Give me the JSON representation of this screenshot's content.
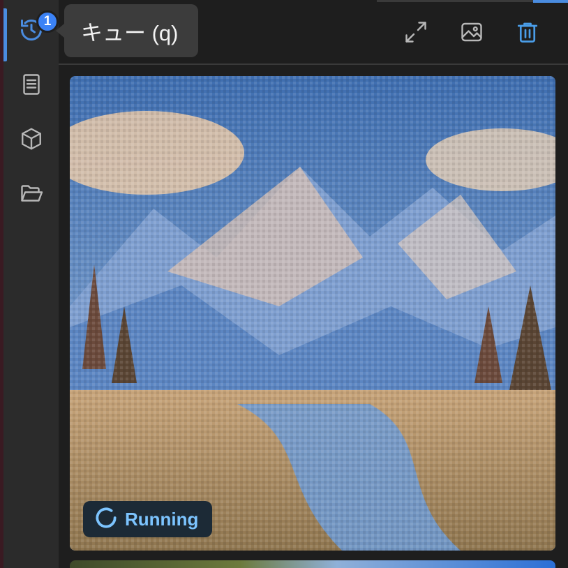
{
  "sidebar": {
    "items": [
      {
        "name": "queue",
        "icon": "history-icon",
        "active": true,
        "badge": "1"
      },
      {
        "name": "library",
        "icon": "book-icon",
        "active": false
      },
      {
        "name": "models",
        "icon": "cube-icon",
        "active": false
      },
      {
        "name": "files",
        "icon": "folder-open-icon",
        "active": false
      }
    ]
  },
  "tooltip": {
    "text": "キュー (q)"
  },
  "header": {
    "actions": [
      {
        "name": "expand",
        "icon": "expand-icon"
      },
      {
        "name": "gallery",
        "icon": "image-icon"
      },
      {
        "name": "delete",
        "icon": "trash-icon",
        "color": "#4a9de8"
      }
    ]
  },
  "queue": {
    "items": [
      {
        "status_label": "Running",
        "status_icon": "spinner-icon",
        "image": "mountain landscape"
      }
    ]
  },
  "colors": {
    "accent": "#4a8ce0",
    "status_text": "#7cc4ff",
    "badge": "#3b82f6"
  }
}
